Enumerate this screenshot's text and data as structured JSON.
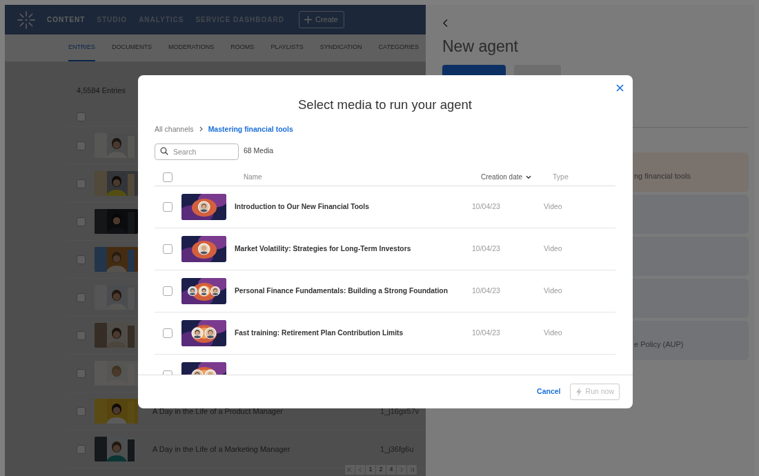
{
  "top_nav": {
    "items": [
      {
        "label": "CONTENT",
        "selected": true
      },
      {
        "label": "STUDIO",
        "selected": false
      },
      {
        "label": "ANALYTICS",
        "selected": false
      },
      {
        "label": "SERVICE DASHBOARD",
        "selected": false
      }
    ],
    "create_button": "Create"
  },
  "sub_tabs": [
    {
      "label": "ENTRIES",
      "selected": true
    },
    {
      "label": "DOCUMENTS",
      "selected": false
    },
    {
      "label": "MODERATIONS",
      "selected": false
    },
    {
      "label": "ROOMS",
      "selected": false
    },
    {
      "label": "PLAYLISTS",
      "selected": false
    },
    {
      "label": "SYNDICATION",
      "selected": false
    },
    {
      "label": "CATEGORIES",
      "selected": false
    }
  ],
  "entries": {
    "count": "4,5584 Entries",
    "all_checked": false,
    "rows": [
      {
        "checked": false
      },
      {
        "checked": false
      },
      {
        "checked": false
      },
      {
        "checked": false
      },
      {
        "checked": false
      },
      {
        "checked": false
      },
      {
        "checked": false
      },
      {
        "checked": false,
        "title": "A Day in the Life of a Product Manager",
        "id": "1_j16gx57v"
      },
      {
        "checked": false,
        "title": "A Day in the Life of a Marketing Manager",
        "id": "1_j36fg6u"
      }
    ],
    "pages": [
      "1",
      "2",
      "4"
    ]
  },
  "drawer": {
    "title": "New agent",
    "cards": [
      {
        "kind": "highlight",
        "text": "ng financial tools"
      },
      {
        "kind": "plain"
      },
      {
        "kind": "plain"
      },
      {
        "kind": "plain"
      },
      {
        "kind": "plain",
        "text": "e Policy (AUP)"
      }
    ]
  },
  "modal": {
    "title": "Select media to run your agent",
    "breadcrumb": [
      "All channels",
      "Mastering financial tools"
    ],
    "search": {
      "placeholder": "Search"
    },
    "media_count": "68 Media",
    "all_checked": false,
    "columns": [
      "Name",
      "Creation date",
      "Type"
    ],
    "rows": [
      {
        "checked": false,
        "title": "Introduction to Our New Financial Tools",
        "date": "10/04/23",
        "type": "Video"
      },
      {
        "checked": false,
        "title": "Market Volatility: Strategies for Long-Term Investors",
        "date": "10/04/23",
        "type": "Video"
      },
      {
        "checked": false,
        "title": "Personal Finance Fundamentals: Building a Strong Foundation",
        "date": "10/04/23",
        "type": "Video"
      },
      {
        "checked": false,
        "title": "Fast training: Retirement Plan Contribution Limits",
        "date": "10/04/23",
        "type": "Video"
      },
      {
        "checked": false
      }
    ],
    "cancel": "Cancel",
    "run_button": {
      "label": "Run now",
      "disabled": true
    }
  }
}
